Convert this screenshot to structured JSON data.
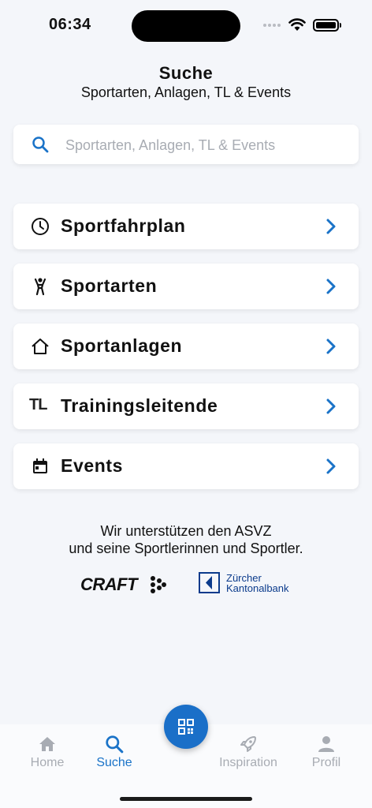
{
  "status": {
    "time": "06:34"
  },
  "header": {
    "title": "Suche",
    "subtitle": "Sportarten, Anlagen, TL & Events"
  },
  "search": {
    "placeholder": "Sportarten, Anlagen, TL & Events"
  },
  "menu": [
    {
      "label": "Sportfahrplan",
      "icon": "clock-icon"
    },
    {
      "label": "Sportarten",
      "icon": "person-icon"
    },
    {
      "label": "Sportanlagen",
      "icon": "house-icon"
    },
    {
      "label": "Trainingsleitende",
      "icon": "tl-icon",
      "icon_text": "TL"
    },
    {
      "label": "Events",
      "icon": "calendar-icon"
    }
  ],
  "sponsors": {
    "line1": "Wir unterstützen den ASVZ",
    "line2": "und seine Sportlerinnen und Sportler.",
    "craft": "CRAFT",
    "zkb_line1": "Zürcher",
    "zkb_line2": "Kantonalbank"
  },
  "tabs": [
    {
      "label": "Home",
      "icon": "home-icon",
      "active": false
    },
    {
      "label": "Suche",
      "icon": "search-icon",
      "active": true
    },
    {
      "label": "Inspiration",
      "icon": "rocket-icon",
      "active": false
    },
    {
      "label": "Profil",
      "icon": "profile-icon",
      "active": false
    }
  ],
  "colors": {
    "accent": "#1a73c8",
    "background": "#f4f6fa",
    "inactive": "#a8acb3"
  }
}
